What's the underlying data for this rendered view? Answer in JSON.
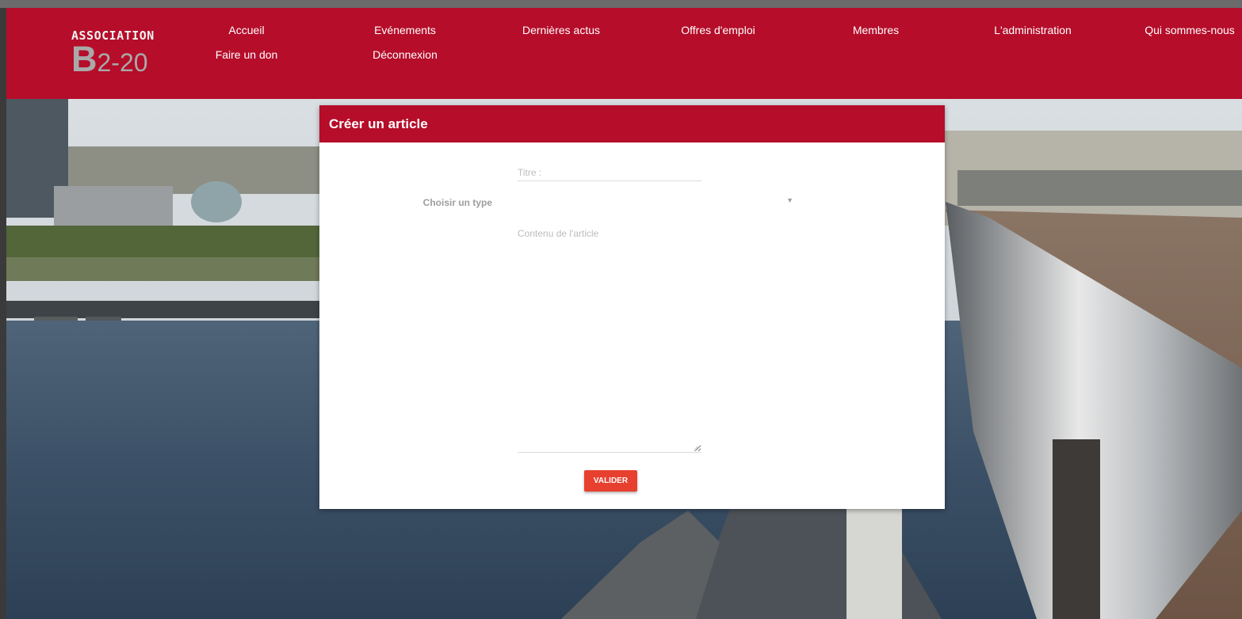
{
  "logo": {
    "line1": "ASSOCIATION",
    "letter": "B",
    "number": "2-20"
  },
  "nav": {
    "accueil": "Accueil",
    "evenements": "Evénements",
    "actus": "Dernières actus",
    "emploi": "Offres d'emploi",
    "membres": "Membres",
    "administration": "L'administration",
    "qui_sommes_nous": "Qui sommes-nous",
    "don": "Faire un don",
    "deconnexion": "Déconnexion"
  },
  "form": {
    "heading": "Créer un article",
    "title_placeholder": "Titre :",
    "title_value": "",
    "type_label": "Choisir un type",
    "type_selected": "",
    "content_placeholder": "Contenu de l'article",
    "content_value": "",
    "submit_label": "VALIDER"
  },
  "colors": {
    "brand": "#b50d2a",
    "button": "#e8402f"
  },
  "icons": {
    "select_arrow": "caret-down-icon",
    "resize": "resize-grip-icon"
  }
}
